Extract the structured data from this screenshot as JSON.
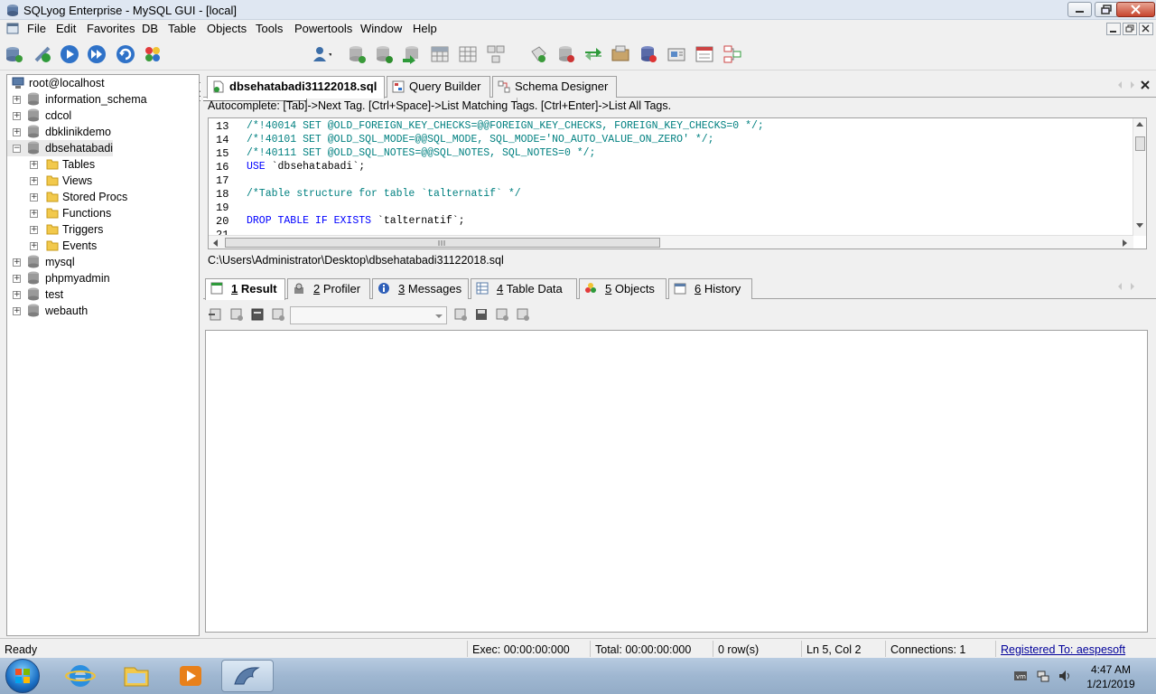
{
  "window": {
    "title": "SQLyog Enterprise - MySQL GUI - [local]"
  },
  "menu": [
    "File",
    "Edit",
    "Favorites",
    "DB",
    "Table",
    "Objects",
    "Tools",
    "Powertools",
    "Window",
    "Help"
  ],
  "toolbar": {
    "database_selector": "dbsehatabadi",
    "icons": [
      "new-connection-icon",
      "connect-icon",
      "execute-query-icon",
      "execute-all-icon",
      "refresh-icon",
      "palette-icon",
      "user-manager-icon",
      "create-database-icon",
      "copy-database-icon",
      "import-icon",
      "table-data-icon",
      "table-grid-icon",
      "schema-icon",
      "restore-icon",
      "backup-icon",
      "sync-icon",
      "query-builder-icon",
      "scheduled-backup-icon",
      "notification-icon",
      "sql-template-icon",
      "schema-sync-icon"
    ]
  },
  "object_browser": {
    "root": "root@localhost",
    "databases": [
      {
        "name": "information_schema",
        "expanded": false
      },
      {
        "name": "cdcol",
        "expanded": false
      },
      {
        "name": "dbklinikdemo",
        "expanded": false
      },
      {
        "name": "dbsehatabadi",
        "expanded": true,
        "children": [
          "Tables",
          "Views",
          "Stored Procs",
          "Functions",
          "Triggers",
          "Events"
        ]
      },
      {
        "name": "mysql",
        "expanded": false
      },
      {
        "name": "phpmyadmin",
        "expanded": false
      },
      {
        "name": "test",
        "expanded": false
      },
      {
        "name": "webauth",
        "expanded": false
      }
    ]
  },
  "query_tabs": [
    {
      "label": "dbsehatabadi31122018.sql",
      "active": true
    },
    {
      "label": "Query Builder",
      "active": false
    },
    {
      "label": "Schema Designer",
      "active": false
    }
  ],
  "editor": {
    "autocomplete_hint": "Autocomplete: [Tab]->Next Tag. [Ctrl+Space]->List Matching Tags. [Ctrl+Enter]->List All Tags.",
    "lines": [
      {
        "num": "13",
        "text": "/*!40014 SET @OLD_FOREIGN_KEY_CHECKS=@@FOREIGN_KEY_CHECKS, FOREIGN_KEY_CHECKS=0 */;",
        "style": "comment"
      },
      {
        "num": "14",
        "text": "/*!40101 SET @OLD_SQL_MODE=@@SQL_MODE, SQL_MODE='NO_AUTO_VALUE_ON_ZERO' */;",
        "style": "comment"
      },
      {
        "num": "15",
        "text": "/*!40111 SET @OLD_SQL_NOTES=@@SQL_NOTES, SQL_NOTES=0 */;",
        "style": "comment"
      },
      {
        "num": "16",
        "keyword": "USE",
        "text": " `dbsehatabadi`;",
        "style": "keyword"
      },
      {
        "num": "17",
        "text": "",
        "style": "plain"
      },
      {
        "num": "18",
        "text": "/*Table structure for table `talternatif` */",
        "style": "comment"
      },
      {
        "num": "19",
        "text": "",
        "style": "plain"
      },
      {
        "num": "20",
        "keyword": "DROP TABLE IF EXISTS",
        "text": " `talternatif`;",
        "style": "keyword"
      },
      {
        "num": "21",
        "text": "",
        "style": "plain"
      }
    ],
    "file_path": "C:\\Users\\Administrator\\Desktop\\dbsehatabadi31122018.sql"
  },
  "result_tabs": [
    {
      "num": "1",
      "label": "Result",
      "active": true
    },
    {
      "num": "2",
      "label": "Profiler",
      "active": false
    },
    {
      "num": "3",
      "label": "Messages",
      "active": false
    },
    {
      "num": "4",
      "label": "Table Data",
      "active": false
    },
    {
      "num": "5",
      "label": "Objects",
      "active": false
    },
    {
      "num": "6",
      "label": "History",
      "active": false
    }
  ],
  "status": {
    "state": "Ready",
    "exec": "Exec: 00:00:00:000",
    "total": "Total: 00:00:00:000",
    "rows": "0 row(s)",
    "position": "Ln 5, Col 2",
    "connections": "Connections: 1",
    "registered": "Registered To: aespesoft"
  },
  "taskbar": {
    "apps": [
      "internet-explorer-icon",
      "file-explorer-icon",
      "media-player-icon",
      "sqlyog-icon"
    ],
    "clock_time": "4:47 AM",
    "clock_date": "1/21/2019"
  },
  "colors": {
    "comment": "#008080",
    "keyword": "#0000ff",
    "link": "#00009a"
  }
}
